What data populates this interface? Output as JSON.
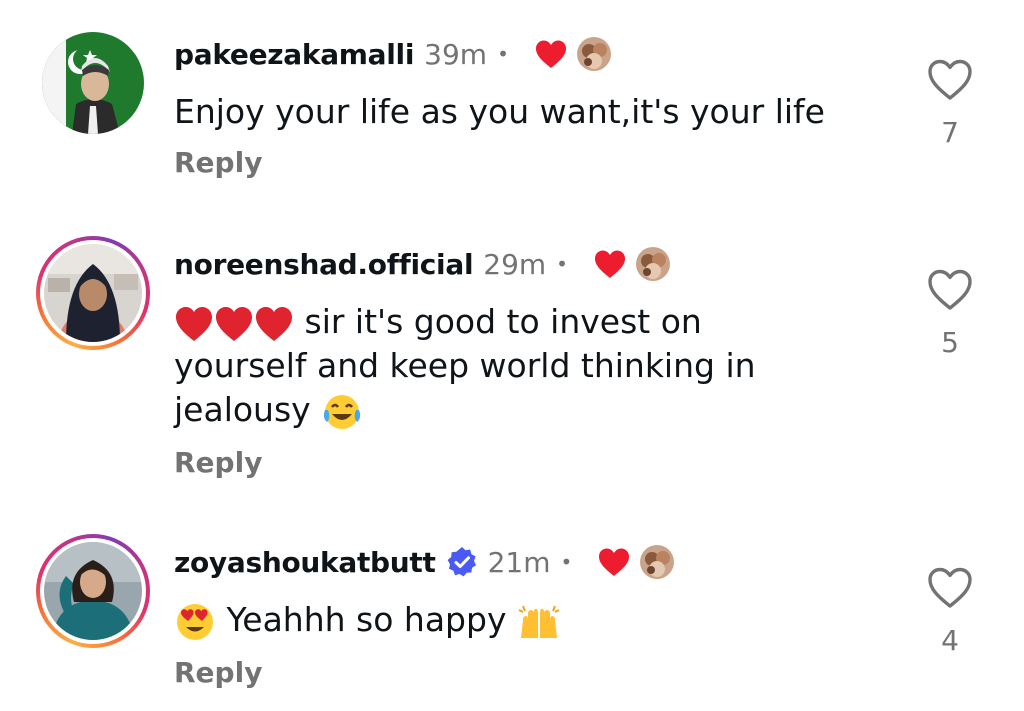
{
  "colors": {
    "heart_red": "#ed1c2e",
    "muted_text": "#737373",
    "primary_text": "#0f1419",
    "verified_blue": "#4a5bf5"
  },
  "comments": [
    {
      "username": "pakeezakamalli",
      "time": "39m",
      "separator": "•",
      "text": "Enjoy your life as you want,it's your life",
      "emojis_before": [],
      "emojis_after": [],
      "reply_label": "Reply",
      "likes": "7",
      "verified": false,
      "avatar_icon": "flag-portrait-avatar",
      "liked_by_author": true
    },
    {
      "username": "noreenshad.official",
      "time": "29m",
      "separator": "•",
      "text": "sir it's good to invest on yourself and keep world thinking in jealousy",
      "emojis_before": [
        "red-heart-emoji",
        "red-heart-emoji",
        "red-heart-emoji"
      ],
      "emojis_after": [
        "tears-of-joy-emoji"
      ],
      "reply_label": "Reply",
      "likes": "5",
      "verified": false,
      "avatar_icon": "woman-hijab-avatar",
      "liked_by_author": true
    },
    {
      "username": "zoyashoukatbutt",
      "time": "21m",
      "separator": "•",
      "text": "Yeahhh so happy",
      "emojis_before": [
        "heart-eyes-emoji"
      ],
      "emojis_after": [
        "raising-hands-emoji"
      ],
      "reply_label": "Reply",
      "likes": "4",
      "verified": true,
      "avatar_icon": "woman-teal-dress-avatar",
      "liked_by_author": true
    }
  ]
}
